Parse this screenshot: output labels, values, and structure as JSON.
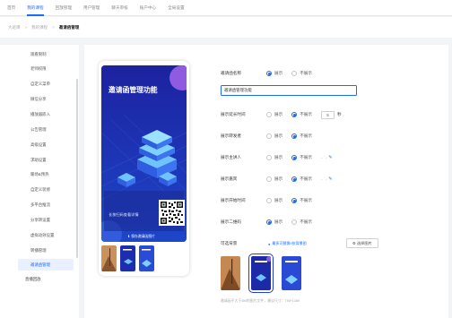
{
  "topnav": {
    "items": [
      "首页",
      "我的课程",
      "回放管理",
      "用户管理",
      "聊天审核",
      "账户中心",
      "全局设置"
    ],
    "active_index": 1
  },
  "breadcrumb": {
    "items": [
      "大班课",
      "我的课程"
    ],
    "current": "邀请函管理"
  },
  "sidebar": {
    "items": [
      "观看限制",
      "老师权限",
      "自定义菜单",
      "微信分享",
      "播放器嵌入",
      "公告管理",
      "高级设置",
      "求助设置",
      "暖场&预热",
      "自定义装修",
      "多平台推流",
      "分享转设置",
      "虚拟动效设置",
      "转播管理",
      "邀请函管理",
      "直播回放"
    ],
    "active": "邀请函管理"
  },
  "preview": {
    "title": "邀请函管理功能",
    "qr_tip": "长按扫码查看详情",
    "save_label": "保存邀请函图片",
    "colors": {
      "poster": "#1a2aa8",
      "accent": "#2f7bff"
    }
  },
  "form": {
    "name_label": "邀请函名称",
    "name_value": "邀请函管理功能",
    "show": "展示",
    "hide": "不展示",
    "name_toggle": "show",
    "duration_label": "展示延长时间",
    "duration_toggle": "hide",
    "duration_value": "5",
    "duration_unit": "秒",
    "inviter_label": "展示转发者",
    "inviter_toggle": "show",
    "lecturer_label": "展示主讲人",
    "lecturer_toggle": "hide",
    "lecturer_dash": "- -",
    "guest_label": "展示嘉宾",
    "guest_toggle": "hide",
    "guest_dash": "- -",
    "start_label": "展示开始时间",
    "start_toggle": "hide",
    "qr_label": "展示二维码",
    "qr_toggle": "show",
    "bg_label": "可选背景",
    "bg_hint": "最多可替换9张背景图",
    "pick_label": "选择图片",
    "note": "邀请函不大于5M的图片文件，建议尺寸：750*1369"
  },
  "colors": {
    "primary": "#1f6bff",
    "active_bg": "#e9f0ff"
  }
}
